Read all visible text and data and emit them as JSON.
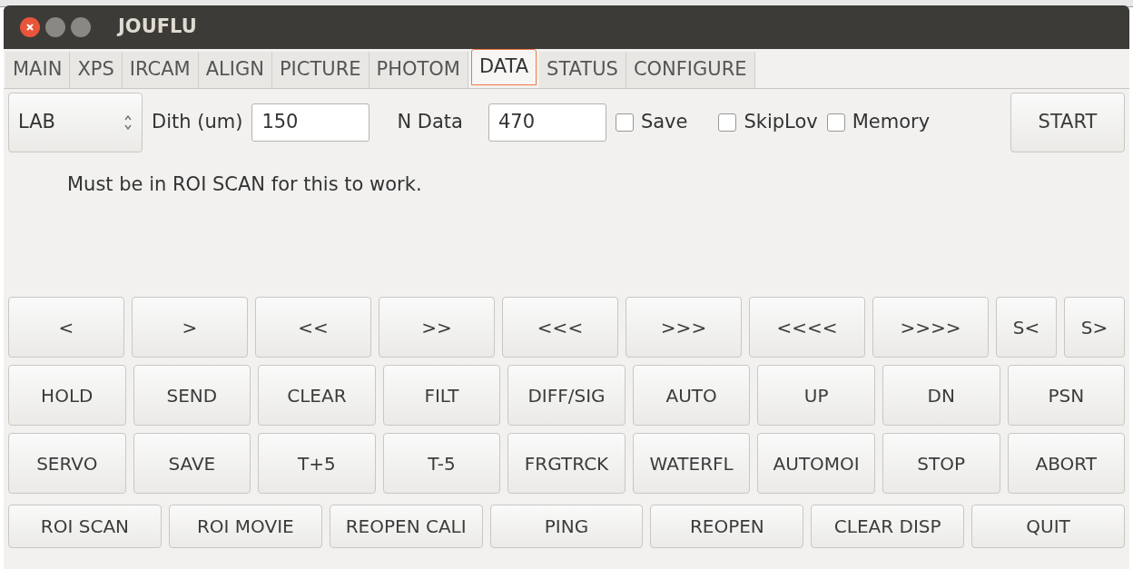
{
  "window": {
    "title": "JOUFLU"
  },
  "tabs": [
    {
      "label": "MAIN",
      "selected": false
    },
    {
      "label": "XPS",
      "selected": false
    },
    {
      "label": "IRCAM",
      "selected": false
    },
    {
      "label": "ALIGN",
      "selected": false
    },
    {
      "label": "PICTURE",
      "selected": false
    },
    {
      "label": "PHOTOM",
      "selected": false
    },
    {
      "label": "DATA",
      "selected": true
    },
    {
      "label": "STATUS",
      "selected": false
    },
    {
      "label": "CONFIGURE",
      "selected": false
    }
  ],
  "mode_spinner": {
    "value": "LAB"
  },
  "fields": [
    {
      "label": "Dith (um)",
      "value": "150"
    },
    {
      "label": "N Data",
      "value": "470"
    }
  ],
  "checkboxes": [
    {
      "label": "Save",
      "checked": false
    },
    {
      "label": "SkipLov",
      "checked": false
    },
    {
      "label": "Memory",
      "checked": false
    }
  ],
  "start_button": "START",
  "message": "Must be in ROI SCAN for this to work.",
  "button_rows": [
    [
      "<",
      ">",
      "<<",
      ">>",
      "<<<",
      ">>>",
      "<<<<",
      ">>>>",
      "S<",
      "S>"
    ],
    [
      "HOLD",
      "SEND",
      "CLEAR",
      "FILT",
      "DIFF/SIG",
      "AUTO",
      "UP",
      "DN",
      "PSN"
    ],
    [
      "SERVO",
      "SAVE",
      "T+5",
      "T-5",
      "FRGTRCK",
      "WATERFL",
      "AUTOMOI",
      "STOP",
      "ABORT"
    ],
    [
      "ROI SCAN",
      "ROI MOVIE",
      "REOPEN CALI",
      "PING",
      "REOPEN",
      "CLEAR DISP",
      "QUIT"
    ]
  ]
}
